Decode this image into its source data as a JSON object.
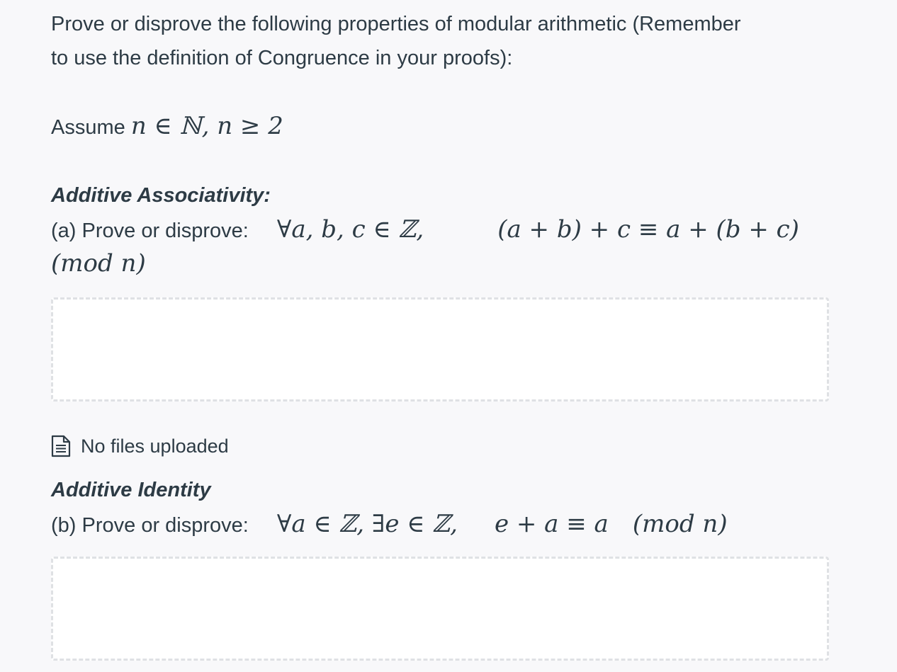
{
  "intro": {
    "line1": "Prove or disprove the following properties of modular arithmetic (Remember",
    "line2": "to use the definition of Congruence in your proofs):"
  },
  "assumption": {
    "label": "Assume",
    "math": "n ∈ ℕ, n ≥ 2"
  },
  "sections": [
    {
      "title": "Additive Associativity:",
      "prompt_label": "(a) Prove or disprove:",
      "quantifier": "∀a, b, c ∈ ℤ,",
      "statement": "(a + b) + c ≡ a + (b + c)",
      "modulus": "(mod n)"
    },
    {
      "title": "Additive Identity",
      "prompt_label": "(b) Prove or disprove:",
      "quantifier": "∀a ∈ ℤ, ∃e ∈ ℤ,",
      "statement": "e + a ≡ a",
      "modulus": "(mod n)"
    }
  ],
  "upload": {
    "icon": "document-icon",
    "status": "No files uploaded"
  }
}
